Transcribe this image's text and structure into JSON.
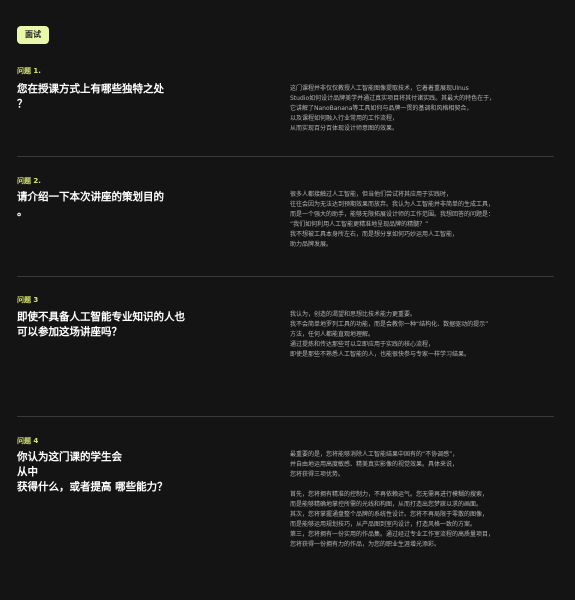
{
  "badge": "面试",
  "questions": [
    {
      "label": "问题 1.",
      "title": "您在授课方式上有哪些独特之处\n？",
      "answer": "这门课程并非仅仅教授人工智能图像提取技术，它着着重展现Ulnus\nStudio如何设计品牌美学并通过真实项目将其付诸实践。其最大的特色在于，\n它讲解了NanoBanana等工具如何与品牌一贯的基调和风格相契合，\n以及课程如何融入行业常用的工作流程，\n从而实现百分百体现设计师意图的效果。"
    },
    {
      "label": "问题 2.",
      "title": "请介绍一下本次讲座的策划目的\n。",
      "answer": "很多人都接触过人工智能，但当他们尝试将其应用于实践时，\n往往会因为无法达到预期效果而放弃。我认为人工智能并非简单的生成工具，\n而是一个强大的助手，能够无限拓展设计师的工作范围。我想回答的问题是：\n“我们如何利用人工智能更精准地呈现品牌的精髓？”\n我不想被工具本身所左右，而是想分享如何巧妙运用人工智能，\n助力品牌发展。"
    },
    {
      "label": "问题 3",
      "title": "即使不具备人工智能专业知识的人也\n可以参加这场讲座吗？",
      "answer": "我认为，创造的渴望和思想比技术能力更重要。\n我不会简单地罗列工具的功能，而是会教你一种“结构化、数据驱动的提示”\n方法，任何人都能直观地理解。\n通过提炼和传达那些可以立即应用于实践的核心流程，\n即使是那些不熟悉人工智能的人，也能很快参与专家一样学习结果。"
    },
    {
      "label": "问题 4",
      "title": "你认为这门课的学生会\n从中\n获得什么，或者提高 哪些能力？",
      "answer": "最重要的是，您将能够消除人工智能结果中固有的“不协调感”，\n并自由地运用高度敏感、精美真实影像的视觉效果。具体来说，\n您将获得三项优势。\n\n首先，您将拥有精准的控制力，不再依赖运气。您无需再进行模糊的搜索，\n而是能够精确地掌控所需的光线和构图，从而打造出您梦寐以求的画面。\n其次，您将掌握通盘整个品牌的系统性设计。您将不再局限于零散的图像，\n而是能够运用规划技巧，从产品图到室内设计，打造风格一致的方案。\n第三，您将拥有一份实用的作品集。通过经过专业工作室流程的高质量项目，\n您将获得一份拥有力的作品，为您的职业生涯增光添彩。"
    }
  ]
}
